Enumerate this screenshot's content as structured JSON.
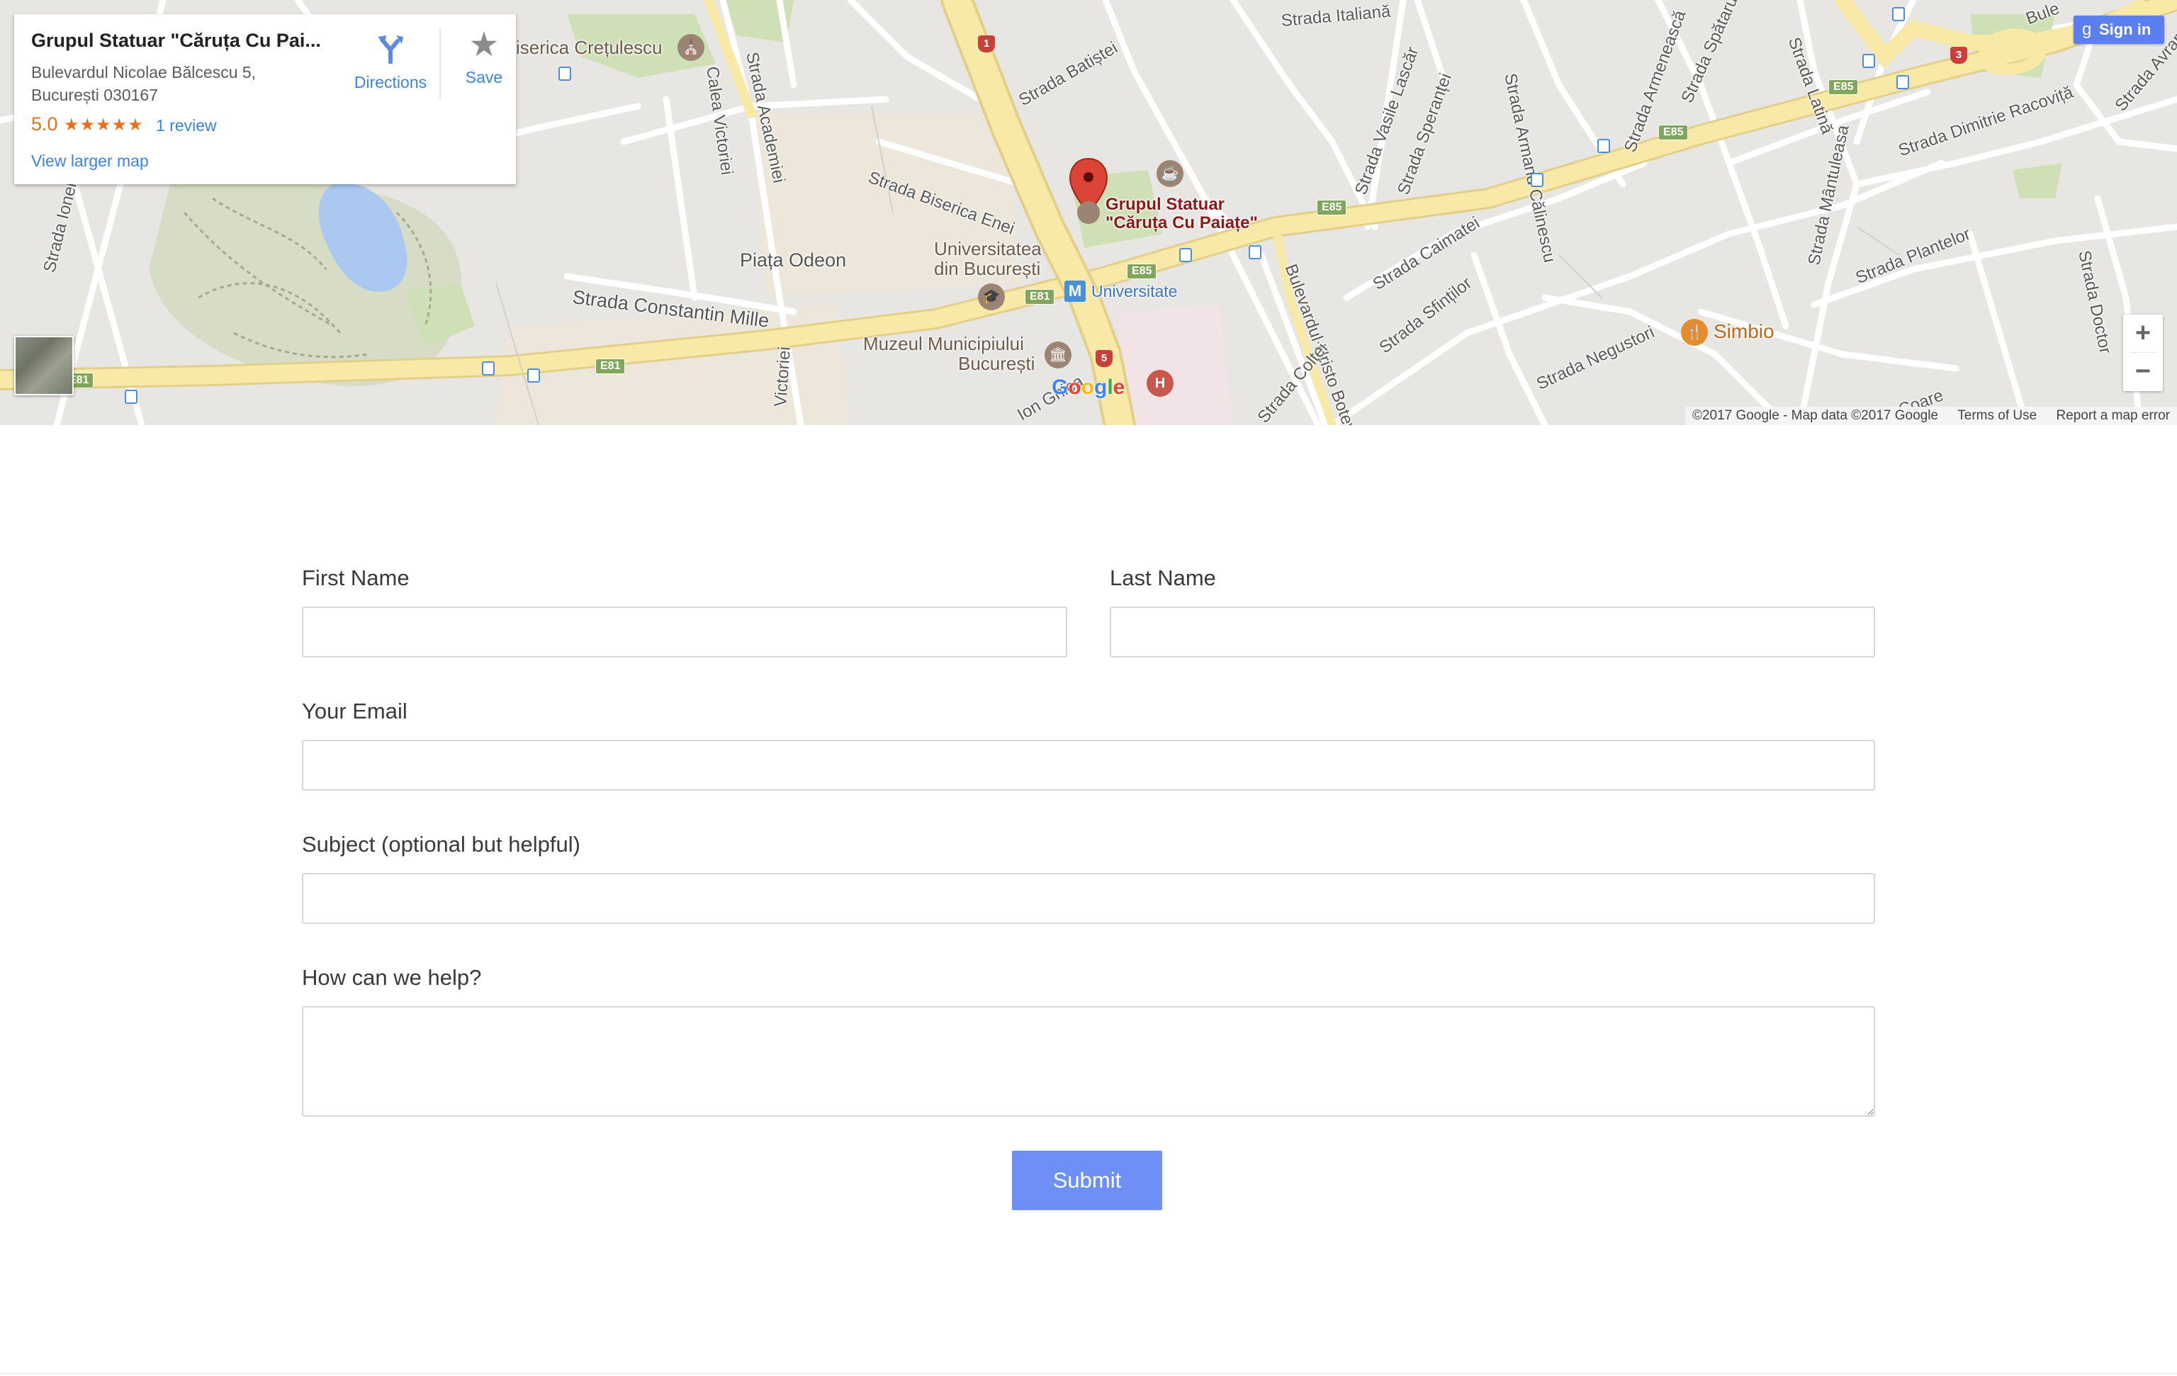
{
  "map": {
    "card": {
      "place_name": "Grupul Statuar \"Căruța Cu Pai...",
      "address_line1": "Bulevardul Nicolae Bălcescu 5,",
      "address_line2": "București 030167",
      "rating": "5.0",
      "stars": "★★★★★",
      "reviews": "1 review",
      "view_larger": "View larger map",
      "directions_label": "Directions",
      "save_label": "Save"
    },
    "sign_in": "Sign in",
    "zoom_in": "+",
    "zoom_out": "−",
    "marker_label_1": "Grupul Statuar",
    "marker_label_2": "\"Căruța Cu Paiațe\"",
    "attribution": {
      "copyright": "©2017 Google - Map data ©2017 Google",
      "terms": "Terms of Use",
      "report": "Report a map error"
    },
    "streets": {
      "italiana": "Strada Italiană",
      "batistei": "Strada Batiștei",
      "armeneasca": "Strada Armenească",
      "spatarului": "Strada Spătarului",
      "latina": "Strada Latină",
      "armand": "Strada Armand Călinescu",
      "vasile": "Strada Vasile Lascăr",
      "sperantei": "Strada Speranței",
      "dimitrie": "Strada Dimitrie Racoviță",
      "manuleasa": "Strada Mântuleasa",
      "plantelor": "Strada Plantelor",
      "caimatei": "Strada Caimatei",
      "sfintilor": "Strada Sfinților",
      "hristo": "Bulevardul Hristo Botev",
      "coltei": "Strada Colței",
      "negustori": "Strada Negustori",
      "doctor": "Strada Doctor",
      "biserica_enei": "Strada Biserica Enei",
      "constantin_mille": "Strada Constantin Mille",
      "calea_victoriei": "Calea Victoriei",
      "academiei": "Strada Academiei",
      "ionel_perlea": "Strada Ionel Perlea",
      "victoriei2": "Victoriei",
      "ion_ghica": "Ion Ghica",
      "avram": "Strada Avram I",
      "bule": "Bule",
      "coare": "Coare"
    },
    "places": {
      "cretulescu": "iserica Crețulescu",
      "piata_odeon": "Piața Odeon",
      "universitatea_1": "Universitatea",
      "universitatea_2": "din București",
      "universitate_metro": "Universitate",
      "muzeul_1": "Muzeul Municipiului",
      "muzeul_2": "București",
      "simbio": "Simbio"
    },
    "shields": [
      "E85",
      "E85",
      "E85",
      "E85",
      "E81",
      "E81",
      "E81"
    ],
    "route_numbers": [
      "1",
      "5",
      "3"
    ]
  },
  "form": {
    "first_name_label": "First Name",
    "last_name_label": "Last Name",
    "email_label": "Your Email",
    "subject_label": "Subject (optional but helpful)",
    "message_label": "How can we help?",
    "first_name_value": "",
    "last_name_value": "",
    "email_value": "",
    "subject_value": "",
    "message_value": "",
    "submit_label": "Submit"
  },
  "colors": {
    "accent": "#6d8ff6",
    "link": "#3a84df",
    "rating": "#e7711b",
    "marker": "#db4437"
  }
}
